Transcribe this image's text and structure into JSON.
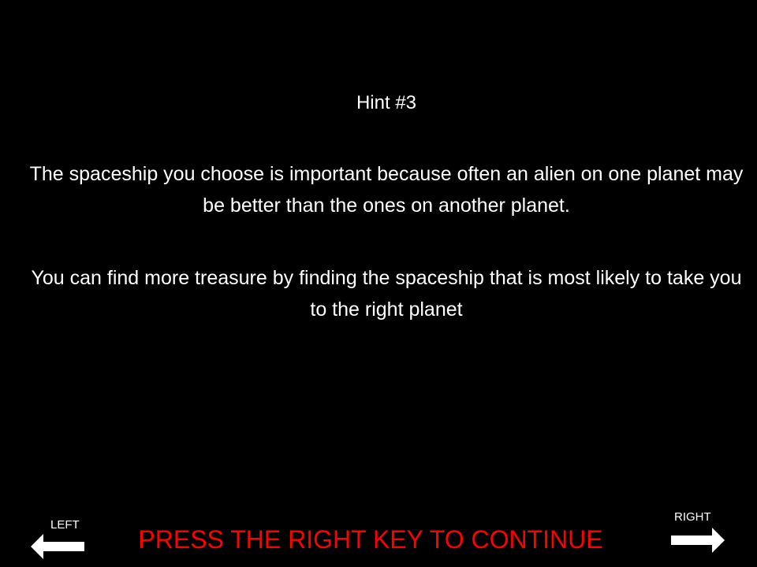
{
  "hint": {
    "title": "Hint #3",
    "paragraphs": [
      "The spaceship you choose is important because often an alien on one planet may be better than the ones on another planet.",
      "You can find more treasure by finding the spaceship that is most likely to take you to the right planet"
    ]
  },
  "controls": {
    "left_label": "LEFT",
    "right_label": "RIGHT",
    "left_icon": "left-arrow-icon",
    "right_icon": "right-arrow-icon"
  },
  "prompt": {
    "text": "PRESS THE RIGHT KEY TO CONTINUE",
    "color": "#ff0000"
  },
  "colors": {
    "background": "#000000",
    "text": "#ffffff",
    "prompt": "#ff0000"
  }
}
